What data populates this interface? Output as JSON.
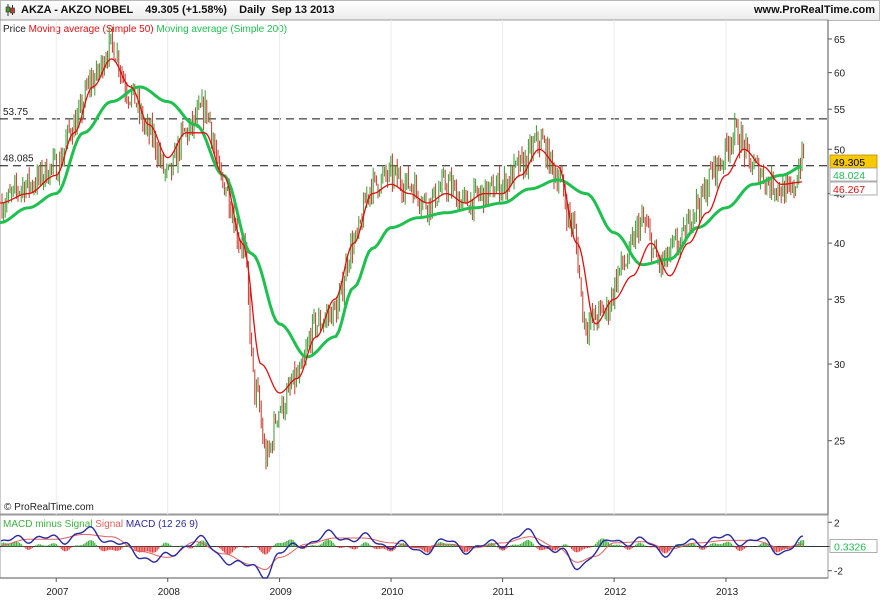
{
  "header": {
    "instrument": "AKZA - AKZO NOBEL",
    "price_change": "49.305 (+1.58%)",
    "period_date": "Daily  Sep 13 2013",
    "site": "www.ProRealTime.com"
  },
  "colors": {
    "price_up": "#3a9a2f",
    "price_down": "#c0392b",
    "ma50": "#e01010",
    "ma200": "#20c050",
    "macd": "#2a2aa0",
    "signal": "#e06060",
    "histogram_pos": "#40b040",
    "histogram_neg": "#e04040",
    "current_price_bg": "#f6c900"
  },
  "chart_data": [
    {
      "type": "line",
      "legend": [
        "Price",
        "Moving average (Simple 50)",
        "Moving average (Simple 200)"
      ],
      "scale": "log",
      "ylim": [
        21,
        68
      ],
      "y_ticks": [
        25,
        30,
        35,
        40,
        45,
        50,
        55,
        60,
        65
      ],
      "x_tick_labels": [
        "2007",
        "2008",
        "2009",
        "2010",
        "2011",
        "2012",
        "2013"
      ],
      "xlim": [
        "2006-07-01",
        "2013-12-01"
      ],
      "hlines": [
        {
          "label": "53.75",
          "value": 53.75
        },
        {
          "label": "48.085",
          "value": 48.085
        }
      ],
      "price_tags": [
        {
          "label": "49.305",
          "value": 49.305,
          "series": "Price"
        },
        {
          "label": "48.024",
          "value": 48.024,
          "series": "Moving average (Simple 200)"
        },
        {
          "label": "46.267",
          "value": 46.267,
          "series": "Moving average (Simple 50)"
        }
      ],
      "watermark": "© ProRealTime.com",
      "series": [
        {
          "name": "Price",
          "x": [
            "2006-07-01",
            "2006-10-01",
            "2007-01-01",
            "2007-03-01",
            "2007-05-01",
            "2007-07-01",
            "2007-09-01",
            "2007-11-01",
            "2008-01-01",
            "2008-03-01",
            "2008-05-01",
            "2008-07-01",
            "2008-09-01",
            "2008-10-15",
            "2008-11-20",
            "2009-01-01",
            "2009-03-01",
            "2009-05-01",
            "2009-07-01",
            "2009-09-01",
            "2009-11-01",
            "2010-01-01",
            "2010-03-01",
            "2010-05-01",
            "2010-07-01",
            "2010-09-01",
            "2010-11-01",
            "2011-01-01",
            "2011-03-01",
            "2011-05-01",
            "2011-07-01",
            "2011-08-15",
            "2011-10-01",
            "2011-12-01",
            "2012-02-01",
            "2012-04-01",
            "2012-06-01",
            "2012-08-01",
            "2012-10-01",
            "2012-12-01",
            "2013-02-01",
            "2013-04-01",
            "2013-06-01",
            "2013-08-01",
            "2013-09-13"
          ],
          "values": [
            44,
            46,
            48,
            53,
            59,
            64,
            57,
            52,
            47,
            52,
            55,
            46,
            40,
            28,
            24,
            27,
            29,
            33,
            34,
            40,
            46,
            47,
            46,
            44,
            46,
            44,
            45,
            46,
            48,
            51,
            47,
            42,
            33,
            34,
            38,
            42,
            38,
            40,
            44,
            48,
            52,
            48,
            46,
            45,
            49.305
          ]
        },
        {
          "name": "Moving average (Simple 50)",
          "x": [
            "2006-07-01",
            "2006-10-01",
            "2007-01-01",
            "2007-03-01",
            "2007-05-01",
            "2007-07-01",
            "2007-09-01",
            "2007-11-01",
            "2008-01-01",
            "2008-03-01",
            "2008-05-01",
            "2008-07-01",
            "2008-09-01",
            "2008-11-01",
            "2009-01-01",
            "2009-03-01",
            "2009-05-01",
            "2009-07-01",
            "2009-09-01",
            "2009-11-01",
            "2010-01-01",
            "2010-03-01",
            "2010-05-01",
            "2010-07-01",
            "2010-09-01",
            "2010-11-01",
            "2011-01-01",
            "2011-03-01",
            "2011-05-01",
            "2011-07-01",
            "2011-09-01",
            "2011-11-01",
            "2012-01-01",
            "2012-03-01",
            "2012-05-01",
            "2012-07-01",
            "2012-09-01",
            "2012-11-01",
            "2013-01-01",
            "2013-03-01",
            "2013-05-01",
            "2013-07-01",
            "2013-09-13"
          ],
          "values": [
            44,
            45,
            47,
            52,
            58,
            62,
            58,
            53,
            49,
            52,
            52,
            47,
            40,
            30,
            28,
            29,
            32,
            35,
            40,
            45,
            46,
            45,
            44,
            45,
            44,
            45,
            45,
            47,
            50,
            48,
            40,
            33,
            35,
            37,
            40,
            37,
            40,
            43,
            47,
            50,
            48,
            46,
            46.267
          ]
        },
        {
          "name": "Moving average (Simple 200)",
          "x": [
            "2006-07-01",
            "2006-10-01",
            "2007-01-01",
            "2007-04-01",
            "2007-07-01",
            "2007-10-01",
            "2008-01-01",
            "2008-04-01",
            "2008-07-01",
            "2008-10-01",
            "2009-01-01",
            "2009-04-01",
            "2009-07-01",
            "2009-09-01",
            "2009-11-01",
            "2010-01-01",
            "2010-04-01",
            "2010-07-01",
            "2010-10-01",
            "2011-01-01",
            "2011-04-01",
            "2011-07-01",
            "2011-10-01",
            "2012-01-01",
            "2012-04-01",
            "2012-07-01",
            "2012-10-01",
            "2013-01-01",
            "2013-04-01",
            "2013-07-01",
            "2013-09-13"
          ],
          "values": [
            42,
            43.5,
            45,
            52,
            56,
            58,
            56,
            53,
            47,
            39,
            33,
            30.5,
            32,
            36,
            39.5,
            41.5,
            42.5,
            43,
            43.5,
            44,
            45.5,
            46.5,
            45,
            41,
            38,
            38.5,
            41.5,
            43.5,
            46,
            47,
            48.024
          ]
        }
      ]
    },
    {
      "type": "line",
      "legend": [
        "MACD minus Signal",
        "Signal",
        "MACD (12 26 9)"
      ],
      "ylim": [
        -2.6,
        2.6
      ],
      "y_ticks": [
        -2,
        0,
        2
      ],
      "xlim": [
        "2006-07-01",
        "2013-12-01"
      ],
      "value_tag": "0.3326",
      "series": [
        {
          "name": "MACD (12 26 9)",
          "x": [
            "2006-07-01",
            "2006-10-01",
            "2007-01-01",
            "2007-04-01",
            "2007-07-01",
            "2007-10-01",
            "2008-01-01",
            "2008-04-01",
            "2008-07-01",
            "2008-10-01",
            "2008-11-15",
            "2009-01-01",
            "2009-04-01",
            "2009-07-01",
            "2009-10-01",
            "2010-01-01",
            "2010-04-01",
            "2010-07-01",
            "2010-10-01",
            "2011-01-01",
            "2011-04-01",
            "2011-07-01",
            "2011-09-01",
            "2011-11-01",
            "2012-01-01",
            "2012-04-01",
            "2012-07-01",
            "2012-10-01",
            "2013-01-01",
            "2013-04-01",
            "2013-07-01",
            "2013-09-13"
          ],
          "values": [
            0.2,
            0.8,
            0.5,
            1.2,
            0.6,
            -0.8,
            -1.0,
            0.7,
            -0.9,
            -1.8,
            -2.2,
            -0.6,
            0.4,
            0.9,
            0.6,
            0.2,
            -0.3,
            0.3,
            -0.2,
            0.4,
            1.0,
            -0.4,
            -1.6,
            -0.5,
            0.6,
            0.3,
            -0.4,
            0.5,
            0.6,
            0.5,
            -0.3,
            0.33
          ]
        },
        {
          "name": "Signal",
          "x": [
            "2006-07-01",
            "2006-10-01",
            "2007-01-01",
            "2007-04-01",
            "2007-07-01",
            "2007-10-01",
            "2008-01-01",
            "2008-04-01",
            "2008-07-01",
            "2008-10-01",
            "2008-11-15",
            "2009-01-01",
            "2009-04-01",
            "2009-07-01",
            "2009-10-01",
            "2010-01-01",
            "2010-04-01",
            "2010-07-01",
            "2010-10-01",
            "2011-01-01",
            "2011-04-01",
            "2011-07-01",
            "2011-09-01",
            "2011-11-01",
            "2012-01-01",
            "2012-04-01",
            "2012-07-01",
            "2012-10-01",
            "2013-01-01",
            "2013-04-01",
            "2013-07-01",
            "2013-09-13"
          ],
          "values": [
            0.1,
            0.6,
            0.6,
            1.0,
            0.8,
            -0.4,
            -0.9,
            0.4,
            -0.6,
            -1.5,
            -1.9,
            -0.9,
            0.2,
            0.7,
            0.7,
            0.3,
            -0.1,
            0.2,
            -0.1,
            0.3,
            0.8,
            -0.1,
            -1.3,
            -0.8,
            0.3,
            0.4,
            -0.2,
            0.3,
            0.5,
            0.5,
            -0.1,
            0.2
          ]
        }
      ]
    }
  ]
}
